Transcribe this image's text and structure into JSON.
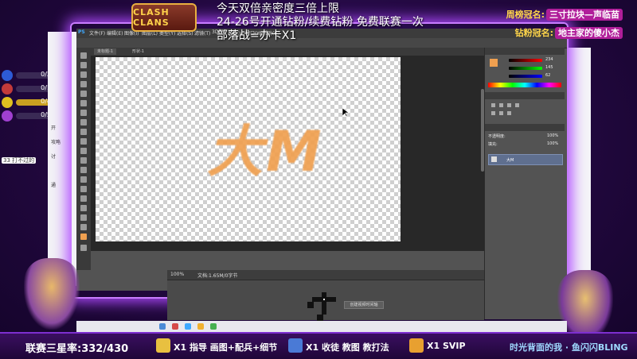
{
  "stream": {
    "notice_line1": "今天双倍亲密度三倍上限",
    "notice_line2": "24-26号开通钻粉/续费钻粉 免费联赛一次",
    "notice_line3": "部落战=办卡X1",
    "logo_text": "CLASH CLANS",
    "sponsor1_label": "周榜冠名:",
    "sponsor1_value": "三寸拉块—声临苗",
    "sponsor2_label": "钻粉冠名:",
    "sponsor2_value": "地主家的傻小杰",
    "stats": [
      {
        "value": "0/2",
        "color": "#2d5bd6"
      },
      {
        "value": "0/1",
        "color": "#c33a3a"
      },
      {
        "value": "0/4",
        "color": "#e0c020"
      },
      {
        "value": "0/5",
        "color": "#a040d0"
      }
    ],
    "chat_line": "33 打不过的"
  },
  "photoshop": {
    "menus": [
      "PS",
      "文件(F)",
      "编辑(E)",
      "图像(I)",
      "图层(L)",
      "类型(Y)",
      "选择(S)",
      "滤镜(T)",
      "3D(D)",
      "视图(V)",
      "窗口(W)",
      "帮助(H)"
    ],
    "doc_tabs": [
      "未标题-1",
      "形状-1"
    ],
    "canvas_text": "大M",
    "status_zoom": "100%",
    "status_doc": "文档:1.65M/0字节",
    "timeline_button": "创建视频时间轴",
    "layer_name": "大M",
    "opacity_label": "不透明度:",
    "opacity_value": "100%",
    "fill_label": "填充:",
    "fill_value": "100%",
    "color_r": "234",
    "color_g": "145",
    "color_b": "62",
    "accent": "#f0a050"
  },
  "browser_sidebar": {
    "items": [
      "开",
      "攻略",
      "讨",
      "通"
    ]
  },
  "bottom": {
    "league_rate": "联赛三星率:332/430",
    "item1": "X1 指导 画图+配兵+细节",
    "item2": "X1  收徒 教图 教打法",
    "item3": "X1  SVIP",
    "scroll_text": "时光背面的我 · 鱼闪闪BLING"
  }
}
